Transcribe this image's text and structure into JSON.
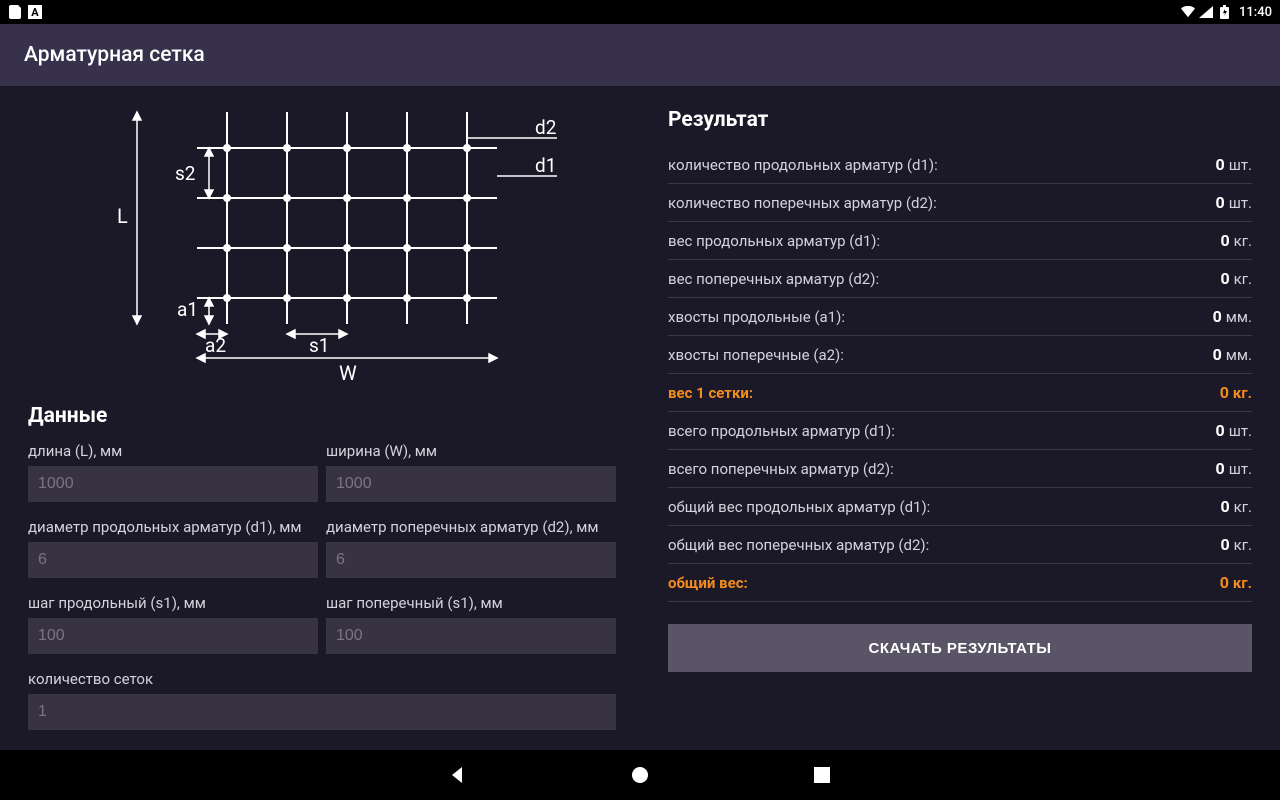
{
  "status": {
    "time": "11:40"
  },
  "header": {
    "title": "Арматурная сетка"
  },
  "diagram": {
    "labels": {
      "L": "L",
      "W": "W",
      "s1": "s1",
      "s2": "s2",
      "a1": "a1",
      "a2": "a2",
      "d1": "d1",
      "d2": "d2"
    }
  },
  "data_section_title": "Данные",
  "fields": {
    "length": {
      "label": "длина (L), мм",
      "placeholder": "1000"
    },
    "width": {
      "label": "ширина (W), мм",
      "placeholder": "1000"
    },
    "d1": {
      "label": "диаметр продольных арматур (d1), мм",
      "placeholder": "6"
    },
    "d2": {
      "label": "диаметр поперечных арматур (d2), мм",
      "placeholder": "6"
    },
    "s1": {
      "label": "шаг продольный (s1), мм",
      "placeholder": "100"
    },
    "s2": {
      "label": "шаг поперечный (s1), мм",
      "placeholder": "100"
    },
    "count": {
      "label": "количество сеток",
      "placeholder": "1"
    }
  },
  "result_section_title": "Результат",
  "results": [
    {
      "label": "количество продольных арматур (d1):",
      "value": "0",
      "unit": "шт.",
      "hl": false
    },
    {
      "label": "количество поперечных арматур (d2):",
      "value": "0",
      "unit": "шт.",
      "hl": false
    },
    {
      "label": "вес продольных арматур (d1):",
      "value": "0",
      "unit": "кг.",
      "hl": false
    },
    {
      "label": "вес поперечных арматур (d2):",
      "value": "0",
      "unit": "кг.",
      "hl": false
    },
    {
      "label": "хвосты продольные (a1):",
      "value": "0",
      "unit": "мм.",
      "hl": false
    },
    {
      "label": "хвосты поперечные (a2):",
      "value": "0",
      "unit": "мм.",
      "hl": false
    },
    {
      "label": "вес 1 сетки:",
      "value": "0",
      "unit": "кг.",
      "hl": true
    },
    {
      "label": "всего продольных арматур (d1):",
      "value": "0",
      "unit": "шт.",
      "hl": false
    },
    {
      "label": "всего поперечных арматур (d2):",
      "value": "0",
      "unit": "шт.",
      "hl": false
    },
    {
      "label": "общий вес продольных арматур (d1):",
      "value": "0",
      "unit": "кг.",
      "hl": false
    },
    {
      "label": "общий вес поперечных арматур (d2):",
      "value": "0",
      "unit": "кг.",
      "hl": false
    },
    {
      "label": "общий вес:",
      "value": "0",
      "unit": "кг.",
      "hl": true
    }
  ],
  "download_label": "СКАЧАТЬ РЕЗУЛЬТАТЫ"
}
